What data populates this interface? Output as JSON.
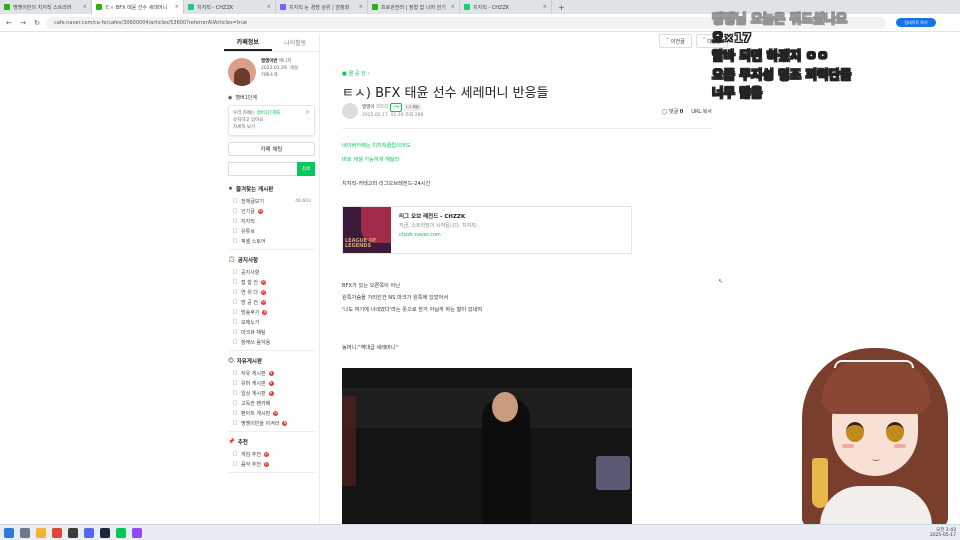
{
  "browser": {
    "tabs": [
      {
        "label": "맹맹이반의 치지직 스트리머",
        "color": "#2db400",
        "active": false
      },
      {
        "label": "ㅌㅅ BFX 태윤 선수 세레머니",
        "color": "#2db400",
        "active": true
      },
      {
        "label": "치지직 - CHZZK",
        "color": "#1ecb7a",
        "active": false
      },
      {
        "label": "치지직 눈 경쟁 상위 | 엄청화",
        "color": "#7b5cff",
        "active": false
      },
      {
        "label": "프로관전러 | 정형 잡 너머 전기",
        "color": "#2db400",
        "active": false
      },
      {
        "label": "치지직 - CHZZK",
        "color": "#1ecb7a",
        "active": false
      }
    ],
    "url": "cafe.naver.com/ca-fe/cafes/30600004/articles/53600?referrerAllArticles=true",
    "profile_label": "업데이트 하기"
  },
  "sidebar": {
    "tabs": [
      "카페정보",
      "나의활동"
    ],
    "cafe": {
      "name": "맹맹이반",
      "role": "매니저",
      "since": "2022.01.29. 개설",
      "extra": "카페소개"
    },
    "membership": "멤버1단계",
    "notice": {
      "line1": "우리 카페는",
      "accent": "멤버1단계를",
      "line2": "유지하고 있어요.",
      "line3": "자세히 보기"
    },
    "write_label": "카페 채팅",
    "search_button": "검색",
    "groups": [
      {
        "title": "즐겨찾는 게시판",
        "icon": "★",
        "items": [
          {
            "label": "전체글보기",
            "count": "46,603",
            "new": false
          },
          {
            "label": "인기글",
            "count": "",
            "new": true
          },
          {
            "label": "지지직",
            "count": "",
            "new": false
          },
          {
            "label": "유튜브",
            "count": "",
            "new": false
          },
          {
            "label": "픽셀 스토어",
            "count": "",
            "new": false
          }
        ]
      },
      {
        "title": "공지사항",
        "icon": "📋",
        "items": [
          {
            "label": "공지사항",
            "count": "",
            "new": false
          },
          {
            "label": "접 합 칸",
            "count": "",
            "new": true
          },
          {
            "label": "연 위 다",
            "count": "",
            "new": true
          },
          {
            "label": "방 공 칸",
            "count": "",
            "new": true
          },
          {
            "label": "방송후기",
            "count": "",
            "new": true
          },
          {
            "label": "모에노기",
            "count": "",
            "new": false
          },
          {
            "label": "마크큐 채팅",
            "count": "",
            "new": false
          },
          {
            "label": "항캐쓰 음악용",
            "count": "",
            "new": false
          }
        ]
      },
      {
        "title": "자유게시판",
        "icon": "😊",
        "items": [
          {
            "label": "자유 게시판",
            "count": "",
            "new": true
          },
          {
            "label": "유머 게시판",
            "count": "",
            "new": true
          },
          {
            "label": "일상 게시판",
            "count": "",
            "new": true
          },
          {
            "label": "고독한 팬카페",
            "count": "",
            "new": false
          },
          {
            "label": "팬아트 게시판",
            "count": "",
            "new": true
          },
          {
            "label": "맹맹이반을 이겨라",
            "count": "",
            "new": true
          }
        ]
      },
      {
        "title": "추천",
        "icon": "📌",
        "items": [
          {
            "label": "게임 추천",
            "count": "",
            "new": true
          },
          {
            "label": "음악 추천",
            "count": "",
            "new": true
          }
        ]
      }
    ]
  },
  "article": {
    "nav_prev": "이전글",
    "nav_next": "다음글",
    "board": "짤 공 칸",
    "title": "ㅌㅅ) BFX 태윤 선수 세레머니 반응들",
    "author": "맹맹이",
    "author_tag": "코토리",
    "badge_sub": "구독",
    "badge_chat": "1:1 채팅",
    "date": "2025.05.17. 01:16",
    "views": "조회 286",
    "comments_label": "댓글",
    "comments_count": "0",
    "copy_url": "URL 복사",
    "links": [
      "네이버카페는 치지직클립이라도",
      "바로 재생 가능하게 해달라"
    ],
    "category_line": "치지직-카테고리 리그오브레전드-24시간",
    "card": {
      "title": "리그 오브 레전드 - CHZZK",
      "desc": "지금, 스트리밍이 시작됩니다. 치지직-",
      "url": "chzzk.naver.com",
      "thumb_text": "LEAGUE OF LEGENDS"
    },
    "para": [
      "BFX가 있는 오른쪽이 아닌",
      "왼쪽가슴을 가리킨건 NS 마크가 왼쪽에 있었어서",
      "'나도 여기에 너네였다'라는 뜻으로 한거 아닐까 하는 말이 있네여"
    ],
    "quote": "농머니:\"역대급 세레머니\""
  },
  "stream_overlay": {
    "lines": [
      "맹맹님 오늘은 뭐드셨나요",
      "요×17",
      "알바 되면 하겠지 ㅇㅇ",
      "요즘 무지성 명조 피력단들",
      "너무 많음"
    ]
  },
  "taskbar": {
    "time": "오전 1:43",
    "date": "2025-05-17"
  },
  "colors": {
    "naver_green": "#03c75a",
    "new_dot": "#e53935"
  }
}
